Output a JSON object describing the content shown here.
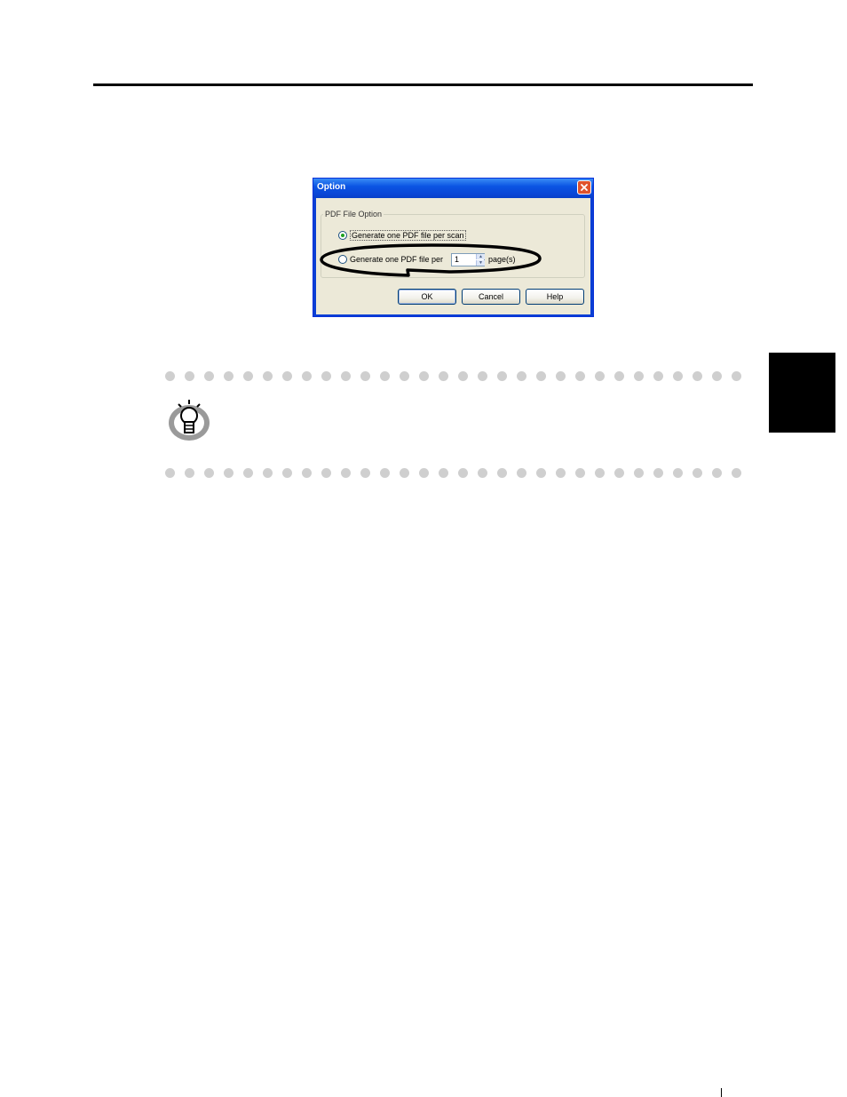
{
  "dialog": {
    "title": "Option",
    "group_label": "PDF File Option",
    "option_per_scan": {
      "label": "Generate one PDF file per scan",
      "selected": true
    },
    "option_per_pages": {
      "label": "Generate one PDF file per",
      "selected": false,
      "page_count": "1",
      "suffix": "page(s)"
    },
    "buttons": {
      "ok": "OK",
      "cancel": "Cancel",
      "help": "Help"
    }
  },
  "icons": {
    "close": "close-icon",
    "hint": "lightbulb-icon"
  },
  "colors": {
    "titlebar": "#0a46d6",
    "callout_outline": "#000000",
    "dot": "#cfcfcf",
    "side_tab": "#000000"
  },
  "page_marker": "I"
}
